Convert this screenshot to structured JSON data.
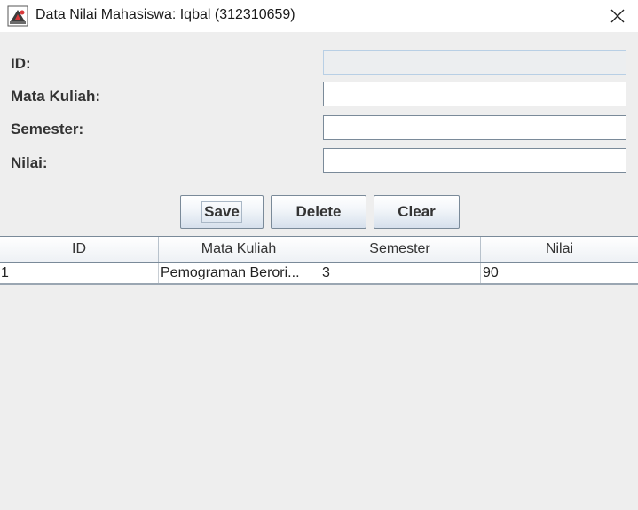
{
  "window": {
    "title": "Data Nilai Mahasiswa: Iqbal (312310659)",
    "icon": "java-app-icon",
    "close_icon": "close-icon"
  },
  "form": {
    "id_label": "ID:",
    "id_value": "",
    "mata_kuliah_label": "Mata Kuliah:",
    "mata_kuliah_value": "",
    "semester_label": "Semester:",
    "semester_value": "",
    "nilai_label": "Nilai:",
    "nilai_value": ""
  },
  "buttons": {
    "save": "Save",
    "delete": "Delete",
    "clear": "Clear"
  },
  "table": {
    "columns": [
      "ID",
      "Mata Kuliah",
      "Semester",
      "Nilai"
    ],
    "rows": [
      [
        "1",
        "Pemograman Berori...",
        "3",
        "90"
      ]
    ]
  }
}
